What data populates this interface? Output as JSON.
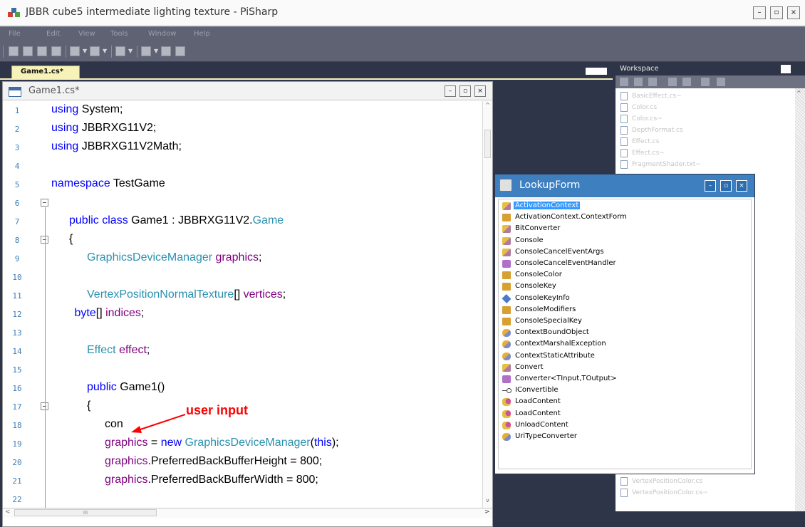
{
  "app": {
    "title": "JBBR cube5 intermediate lighting texture - PiSharp",
    "window_buttons": [
      "–",
      "▫",
      "×"
    ]
  },
  "menu": [
    "File",
    "Edit",
    "View",
    "Tools",
    "Window",
    "Help"
  ],
  "document_tab": {
    "label": "Game1.cs*"
  },
  "editor": {
    "title": "Game1.cs*",
    "scroll_arrow_up": "^",
    "scroll_arrow_down": "v",
    "hscroll_left": "<",
    "hscroll_right": ">",
    "hscroll_thumb": "III",
    "lines": [
      {
        "num": "1",
        "indent": 0,
        "parts": [
          {
            "t": "using",
            "c": "kw"
          },
          {
            "t": " System;",
            "c": ""
          }
        ]
      },
      {
        "num": "2",
        "indent": 0,
        "parts": [
          {
            "t": "using",
            "c": "kw"
          },
          {
            "t": " JBBRXG11V2;",
            "c": ""
          }
        ]
      },
      {
        "num": "3",
        "indent": 0,
        "parts": [
          {
            "t": "using",
            "c": "kw"
          },
          {
            "t": " JBBRXG11V2Math;",
            "c": ""
          }
        ]
      },
      {
        "num": "4",
        "indent": 0,
        "parts": []
      },
      {
        "num": "5",
        "indent": 0,
        "parts": [
          {
            "t": "namespace",
            "c": "kw"
          },
          {
            "t": " TestGame",
            "c": ""
          }
        ]
      },
      {
        "num": "6",
        "indent": -12,
        "parts": [
          {
            "t": "{",
            "c": ""
          }
        ]
      },
      {
        "num": "7",
        "indent": 1,
        "parts": [
          {
            "t": "public class",
            "c": "kw"
          },
          {
            "t": " Game1 : JBBRXG11V2.",
            "c": ""
          },
          {
            "t": "Game",
            "c": "ty"
          }
        ]
      },
      {
        "num": "8",
        "indent": 1,
        "parts": [
          {
            "t": "{",
            "c": ""
          }
        ]
      },
      {
        "num": "9",
        "indent": 2,
        "parts": [
          {
            "t": "GraphicsDeviceManager",
            "c": "ty"
          },
          {
            "t": " ",
            "c": ""
          },
          {
            "t": "graphics",
            "c": "id"
          },
          {
            "t": ";",
            "c": ""
          }
        ]
      },
      {
        "num": "10",
        "indent": 0,
        "parts": []
      },
      {
        "num": "11",
        "indent": 2,
        "parts": [
          {
            "t": "VertexPositionNormalTexture",
            "c": "ty"
          },
          {
            "t": "[] ",
            "c": ""
          },
          {
            "t": "vertices",
            "c": "id"
          },
          {
            "t": ";",
            "c": ""
          }
        ]
      },
      {
        "num": "12",
        "indent": 1.3,
        "parts": [
          {
            "t": "byte",
            "c": "kw"
          },
          {
            "t": "[] ",
            "c": ""
          },
          {
            "t": "indices",
            "c": "id"
          },
          {
            "t": ";",
            "c": ""
          }
        ]
      },
      {
        "num": "13",
        "indent": 0,
        "parts": []
      },
      {
        "num": "14",
        "indent": 2,
        "parts": [
          {
            "t": "Effect",
            "c": "ty"
          },
          {
            "t": " ",
            "c": ""
          },
          {
            "t": "effect",
            "c": "id"
          },
          {
            "t": ";",
            "c": ""
          }
        ]
      },
      {
        "num": "15",
        "indent": 0,
        "parts": []
      },
      {
        "num": "16",
        "indent": 2,
        "parts": [
          {
            "t": "public",
            "c": "kw"
          },
          {
            "t": " Game1()",
            "c": ""
          }
        ]
      },
      {
        "num": "17",
        "indent": 2,
        "parts": [
          {
            "t": "{",
            "c": ""
          }
        ]
      },
      {
        "num": "18",
        "indent": 3,
        "parts": [
          {
            "t": "con",
            "c": ""
          }
        ]
      },
      {
        "num": "19",
        "indent": 3,
        "parts": [
          {
            "t": "graphics",
            "c": "id"
          },
          {
            "t": " = ",
            "c": ""
          },
          {
            "t": "new",
            "c": "kw"
          },
          {
            "t": " ",
            "c": ""
          },
          {
            "t": "GraphicsDeviceManager",
            "c": "ty"
          },
          {
            "t": "(",
            "c": ""
          },
          {
            "t": "this",
            "c": "kw"
          },
          {
            "t": ");",
            "c": ""
          }
        ]
      },
      {
        "num": "20",
        "indent": 3,
        "parts": [
          {
            "t": "graphics",
            "c": "id"
          },
          {
            "t": ".PreferredBackBufferHeight = 800;",
            "c": ""
          }
        ]
      },
      {
        "num": "21",
        "indent": 3,
        "parts": [
          {
            "t": "graphics",
            "c": "id"
          },
          {
            "t": ".PreferredBackBufferWidth = 800;",
            "c": ""
          }
        ]
      },
      {
        "num": "22",
        "indent": 0,
        "parts": []
      }
    ]
  },
  "annotation": {
    "label": "user input",
    "color": "#ff0000"
  },
  "workspace": {
    "title": "Workspace",
    "files_top": [
      "BasicEffect.cs~",
      "Color.cs",
      "Color.cs~",
      "DepthFormat.cs",
      "Effect.cs",
      "Effect.cs~",
      "FragmentShader.txt~"
    ],
    "files_bottom": [
      "VertexPositionColor.cs",
      "VertexPositionColor.cs~"
    ]
  },
  "lookup": {
    "title": "LookupForm",
    "items": [
      {
        "label": "ActivationContext",
        "icon": "class",
        "selected": true
      },
      {
        "label": "ActivationContext.ContextForm",
        "icon": "enum",
        "selected": false
      },
      {
        "label": "BitConverter",
        "icon": "class",
        "selected": false
      },
      {
        "label": "Console",
        "icon": "class",
        "selected": false
      },
      {
        "label": "ConsoleCancelEventArgs",
        "icon": "class",
        "selected": false
      },
      {
        "label": "ConsoleCancelEventHandler",
        "icon": "delegate",
        "selected": false
      },
      {
        "label": "ConsoleColor",
        "icon": "enum",
        "selected": false
      },
      {
        "label": "ConsoleKey",
        "icon": "enum",
        "selected": false
      },
      {
        "label": "ConsoleKeyInfo",
        "icon": "struct",
        "selected": false
      },
      {
        "label": "ConsoleModifiers",
        "icon": "enum",
        "selected": false
      },
      {
        "label": "ConsoleSpecialKey",
        "icon": "enum",
        "selected": false
      },
      {
        "label": "ContextBoundObject",
        "icon": "obj",
        "selected": false
      },
      {
        "label": "ContextMarshalException",
        "icon": "obj",
        "selected": false
      },
      {
        "label": "ContextStaticAttribute",
        "icon": "obj",
        "selected": false
      },
      {
        "label": "Convert",
        "icon": "class",
        "selected": false
      },
      {
        "label": "Converter<TInput,TOutput>",
        "icon": "delegate",
        "selected": false
      },
      {
        "label": "IConvertible",
        "icon": "iface",
        "selected": false
      },
      {
        "label": "LoadContent",
        "icon": "method",
        "selected": false
      },
      {
        "label": "LoadContent",
        "icon": "method",
        "selected": false
      },
      {
        "label": "UnloadContent",
        "icon": "method",
        "selected": false
      },
      {
        "label": "UriTypeConverter",
        "icon": "obj",
        "selected": false
      }
    ]
  },
  "colors": {
    "keyword": "#0000ff",
    "type": "#2b91af",
    "identifier": "#800080",
    "selection": "#3399ff",
    "lookup_titlebar": "#3d7fbf",
    "backdrop": "#2f3548"
  }
}
